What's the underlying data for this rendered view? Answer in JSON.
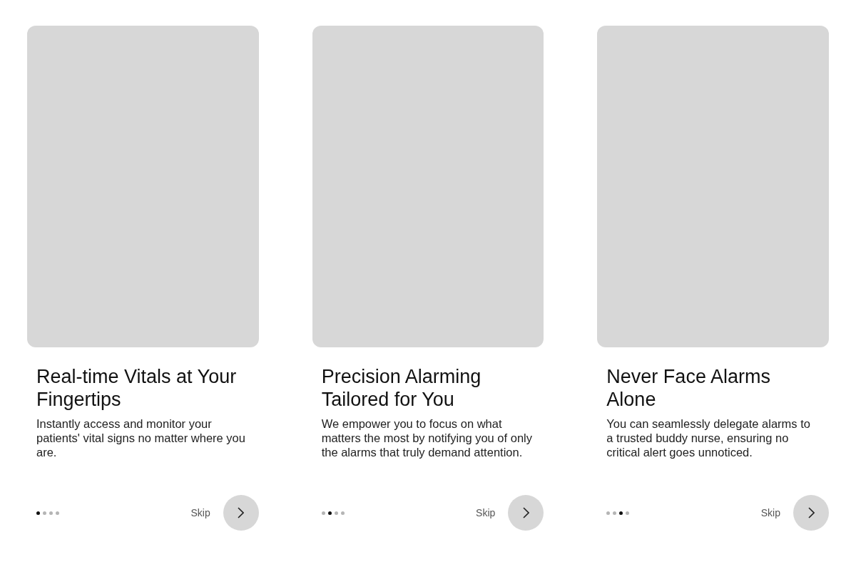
{
  "screens": [
    {
      "title": "Real-time Vitals at Your Fingertips",
      "body": "Instantly access and monitor your patients' vital signs no matter where you are.",
      "dots": [
        {
          "selected": true
        },
        {
          "selected": false
        },
        {
          "selected": false
        },
        {
          "selected": false
        }
      ],
      "skip": "Skip"
    },
    {
      "title": "Precision Alarming Tailored for You",
      "body": "We empower you to focus on what matters the most by notifying you of only the alarms that truly demand attention.",
      "dots": [
        {
          "selected": false
        },
        {
          "selected": true
        },
        {
          "selected": false
        },
        {
          "selected": false
        }
      ],
      "skip": "Skip"
    },
    {
      "title": "Never Face Alarms Alone",
      "body": "You can seamlessly delegate alarms to a trusted buddy nurse, ensuring no critical alert goes unnoticed.",
      "dots": [
        {
          "selected": false
        },
        {
          "selected": false
        },
        {
          "selected": true
        },
        {
          "selected": false
        }
      ],
      "skip": "Skip"
    }
  ]
}
